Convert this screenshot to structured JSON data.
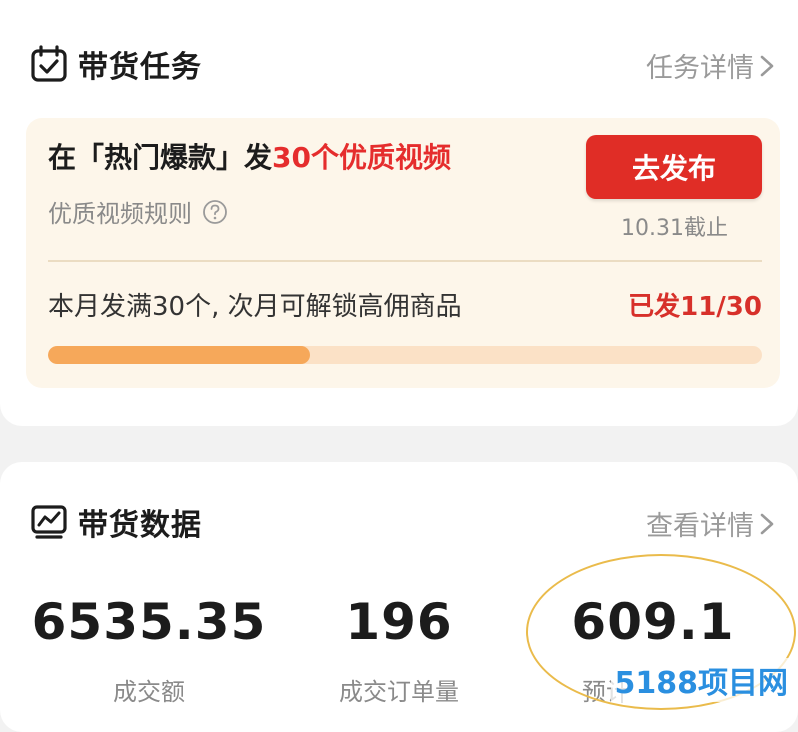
{
  "task_section": {
    "title": "带货任务",
    "more_label": "任务详情",
    "icon": "calendar-check-icon",
    "task": {
      "line_prefix": "在「热门爆款」发",
      "line_highlight": "30个优质视频",
      "rule_label": "优质视频规则",
      "button_label": "去发布",
      "deadline": "10.31截止",
      "unlock_text": "本月发满30个, 次月可解锁高佣商品",
      "sent_count": "已发11/30",
      "progress": 0.367
    }
  },
  "data_section": {
    "title": "带货数据",
    "more_label": "查看详情",
    "icon": "trend-chart-icon",
    "stats": [
      {
        "value": "6535.35",
        "label": "成交额"
      },
      {
        "value": "196",
        "label": "成交订单量"
      },
      {
        "value": "609.1",
        "label": "预计"
      }
    ]
  },
  "watermark": "5188项目网",
  "colors": {
    "accent_red": "#e02d26",
    "progress_fill": "#f6a85a",
    "annotation_circle": "#eabb4b"
  }
}
